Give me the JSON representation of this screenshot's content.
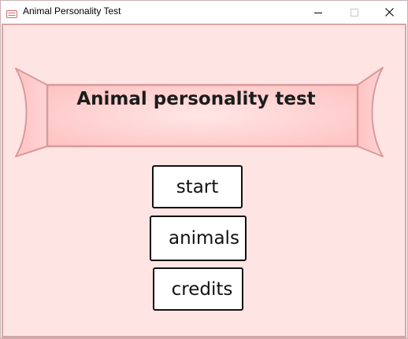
{
  "window": {
    "title": "Animal Personality Test",
    "icon": "app-card-icon",
    "controls": [
      "minimize-icon",
      "maximize-icon",
      "close-icon"
    ]
  },
  "banner": {
    "title": "Animal personality test",
    "colors": {
      "fill_light": "#ffe6e6",
      "fill_mid": "#ffc9c9",
      "stroke": "#d99a9a"
    }
  },
  "menu": {
    "start_label": "start",
    "animals_label": "animals",
    "credits_label": "credits"
  },
  "colors": {
    "background": "#ffe4e4",
    "border": "#d6a6a6",
    "button_bg": "#ffffff",
    "button_border": "#111111"
  }
}
